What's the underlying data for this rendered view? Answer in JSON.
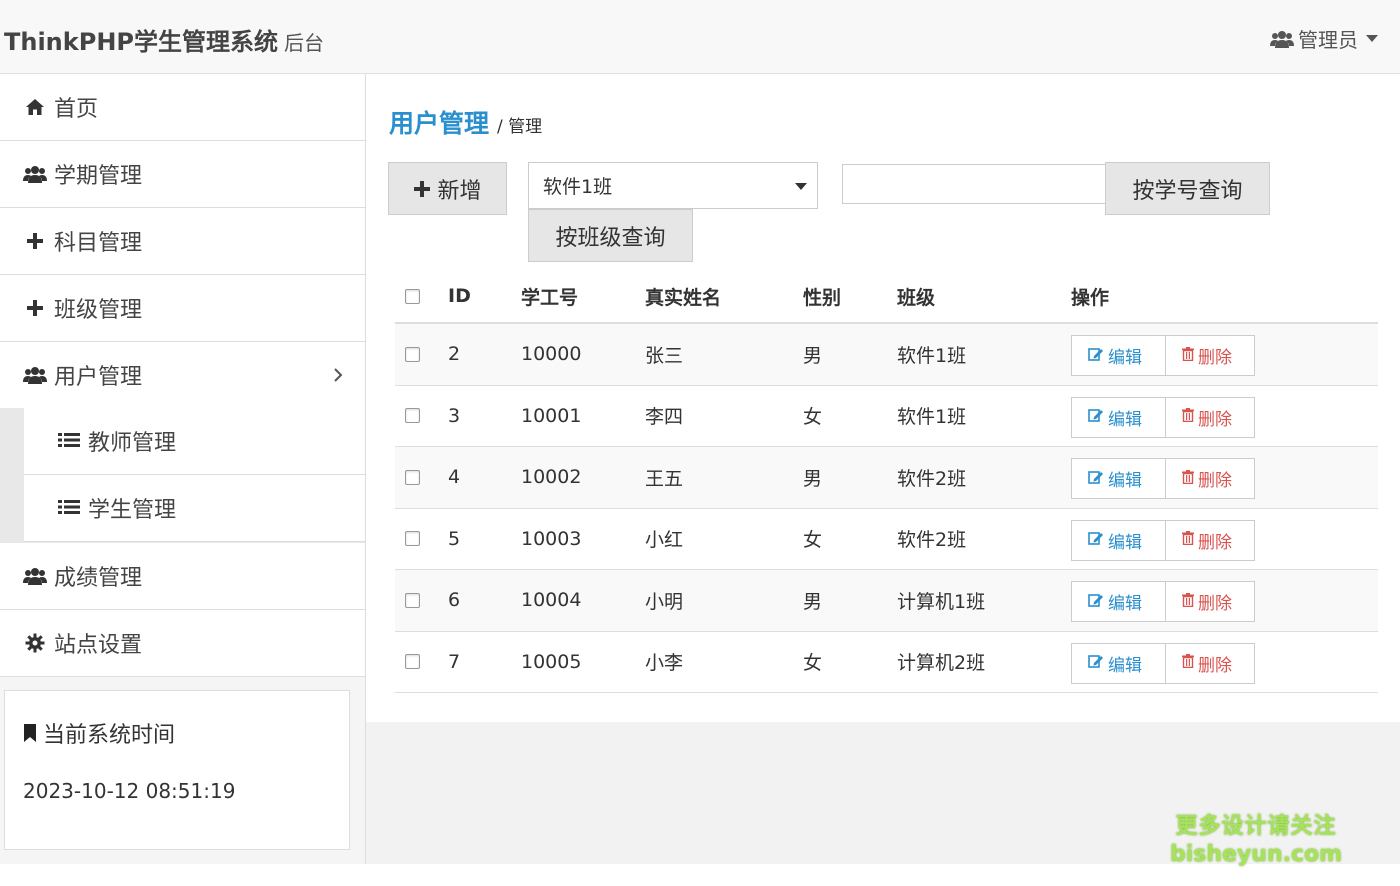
{
  "header": {
    "brand": "ThinkPHP学生管理系统",
    "brand_sub": "后台",
    "user_label": "管理员"
  },
  "sidebar": {
    "items": [
      {
        "label": "首页",
        "icon": "home-icon"
      },
      {
        "label": "学期管理",
        "icon": "users-icon"
      },
      {
        "label": "科目管理",
        "icon": "plus-icon"
      },
      {
        "label": "班级管理",
        "icon": "plus-icon"
      },
      {
        "label": "用户管理",
        "icon": "users-icon",
        "expanded": true
      },
      {
        "label": "成绩管理",
        "icon": "users-icon"
      },
      {
        "label": "站点设置",
        "icon": "gear-icon"
      }
    ],
    "sub_items": [
      {
        "label": "教师管理",
        "icon": "list-icon"
      },
      {
        "label": "学生管理",
        "icon": "list-icon"
      }
    ],
    "time_panel": {
      "title": "当前系统时间",
      "value": "2023-10-12 08:51:19"
    }
  },
  "main": {
    "breadcrumb_main": "用户管理",
    "breadcrumb_sub": "/ 管理",
    "toolbar": {
      "add_label": "新增",
      "class_select_value": "软件1班",
      "query_class_label": "按班级查询",
      "student_no_input": "",
      "query_no_label": "按学号查询"
    },
    "table": {
      "columns": [
        "ID",
        "学工号",
        "真实姓名",
        "性别",
        "班级",
        "操作"
      ],
      "rows": [
        {
          "id": "2",
          "no": "10000",
          "name": "张三",
          "gender": "男",
          "class": "软件1班"
        },
        {
          "id": "3",
          "no": "10001",
          "name": "李四",
          "gender": "女",
          "class": "软件1班"
        },
        {
          "id": "4",
          "no": "10002",
          "name": "王五",
          "gender": "男",
          "class": "软件2班"
        },
        {
          "id": "5",
          "no": "10003",
          "name": "小红",
          "gender": "女",
          "class": "软件2班"
        },
        {
          "id": "6",
          "no": "10004",
          "name": "小明",
          "gender": "男",
          "class": "计算机1班"
        },
        {
          "id": "7",
          "no": "10005",
          "name": "小李",
          "gender": "女",
          "class": "计算机2班"
        }
      ],
      "edit_label": "编辑",
      "delete_label": "删除"
    }
  },
  "watermark": {
    "line1": "更多设计请关注",
    "line2": "bisheyun.com"
  },
  "colors": {
    "accent": "#2a8fcf",
    "danger": "#d9534f",
    "watermark": "#a6e35a"
  }
}
